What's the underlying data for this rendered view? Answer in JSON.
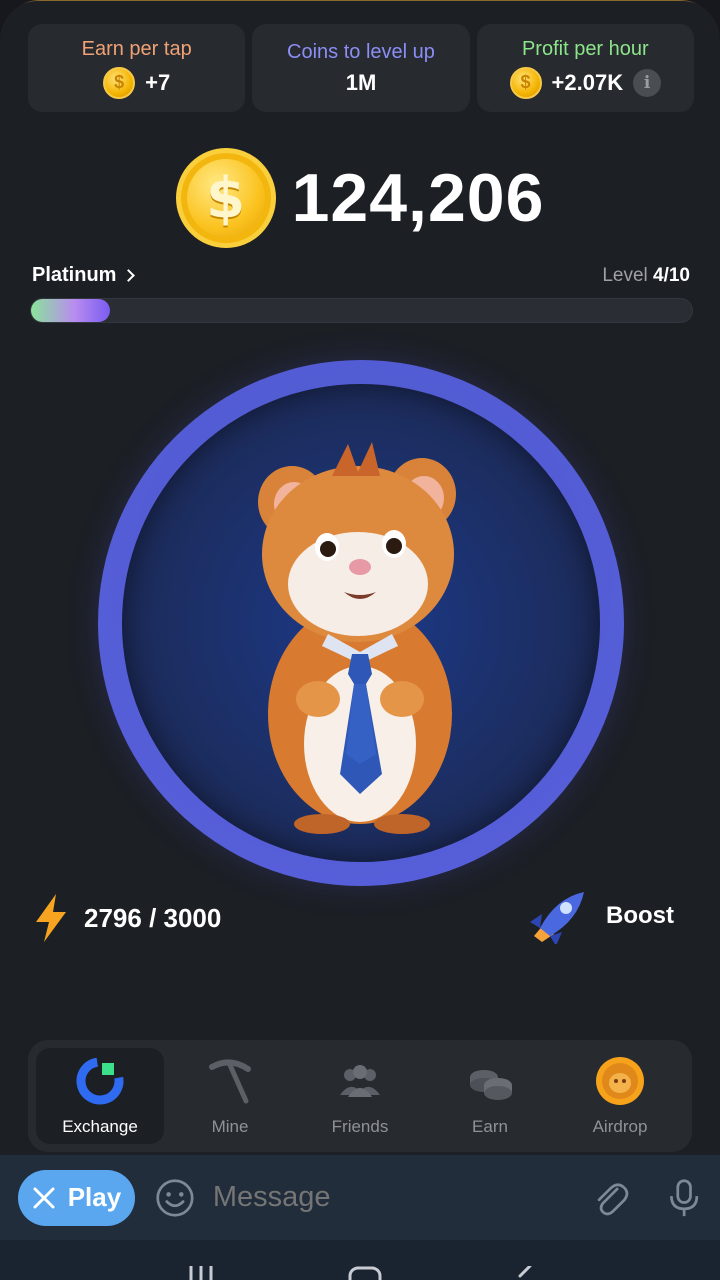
{
  "stats": {
    "earn_per_tap": {
      "label": "Earn per tap",
      "value": "+7",
      "icon": "coin-icon",
      "color": "#f0a275"
    },
    "coins_to_level": {
      "label": "Coins to level up",
      "value": "1M",
      "color": "#8b8ef5"
    },
    "profit_per_hour": {
      "label": "Profit per hour",
      "value": "+2.07K",
      "icon": "coin-icon",
      "info_icon": "info-icon",
      "color": "#8ce58a"
    }
  },
  "balance": {
    "value": "124,206",
    "icon": "dollar-coin-icon"
  },
  "level": {
    "rank": "Platinum",
    "level_label": "Level",
    "level_value": "4/10",
    "progress_fraction": 0.12
  },
  "tap_target": {
    "character": "hamster-ceo-icon"
  },
  "energy": {
    "value": "2796 / 3000",
    "icon": "lightning-icon"
  },
  "boost": {
    "label": "Boost",
    "icon": "rocket-icon"
  },
  "nav": {
    "items": [
      {
        "label": "Exchange",
        "icon": "exchange-icon",
        "active": true
      },
      {
        "label": "Mine",
        "icon": "pickaxe-icon",
        "active": false
      },
      {
        "label": "Friends",
        "icon": "friends-icon",
        "active": false
      },
      {
        "label": "Earn",
        "icon": "coins-stack-icon",
        "active": false
      },
      {
        "label": "Airdrop",
        "icon": "airdrop-coin-icon",
        "active": false
      }
    ]
  },
  "message_bar": {
    "play_label": "Play",
    "placeholder": "Message"
  },
  "colors": {
    "accent": "#5aa7ef",
    "background": "#1c1f24",
    "card": "#272a2f"
  }
}
